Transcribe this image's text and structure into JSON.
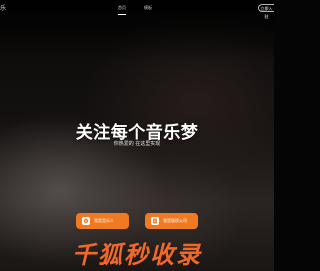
{
  "brand": {
    "text": "乐"
  },
  "nav": {
    "items": [
      {
        "label": "首页",
        "active": true
      },
      {
        "label": "模板",
        "active": false
      }
    ]
  },
  "header": {
    "corner_button": "立即入驻"
  },
  "hero": {
    "headline": "关注每个音乐梦",
    "subline": "你热爱的 在这里实现"
  },
  "actions": {
    "left_button": "我是音乐人",
    "right_button": "我是版权公司",
    "accent": "#f07a22"
  },
  "watermark": {
    "text": "千狐秒收录",
    "color": "#f2682a"
  }
}
